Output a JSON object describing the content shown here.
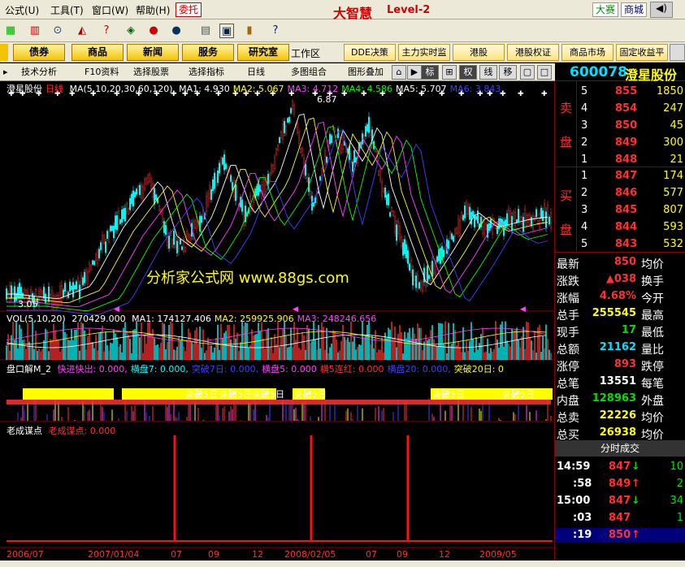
{
  "app": {
    "logo_text": "大智慧",
    "level_text": "Level-2"
  },
  "menu": {
    "items": [
      "公式(U)",
      "工具(T)",
      "窗口(W)",
      "帮助(H)"
    ],
    "tag_left": "委托",
    "tag_right1": "大赛",
    "tag_right2": "商城"
  },
  "toolbar": {
    "icons": [
      "grid-icon",
      "bars-icon",
      "binoculars-icon",
      "megaphone-icon",
      "question-icon",
      "scroll-icon",
      "flag-icon",
      "f10-icon",
      "chart-icon",
      "window-icon",
      "books-icon",
      "help-icon"
    ]
  },
  "funcbar": {
    "buttons": [
      "债券",
      "商品",
      "新闻",
      "服务",
      "研究室"
    ],
    "workspace": "工作区",
    "buttons2": [
      "DDE决策",
      "主力实时监控",
      "港股",
      "港股权证",
      "商品市场",
      "固定收益平台"
    ]
  },
  "tabs": {
    "items": [
      "技术分析",
      "F10资料",
      "选择股票",
      "选择指标",
      "日线",
      "多图组合",
      "图形叠加"
    ],
    "ctrl": [
      "标",
      "⊞",
      "权",
      "线",
      "移"
    ]
  },
  "chart": {
    "title": "澄星股份",
    "period": "日线",
    "ma_label": "MA(5,10,20,30,60,120)",
    "ma_values": [
      {
        "k": "MA1:",
        "v": "4.930",
        "c": "#ffffff"
      },
      {
        "k": "MA2:",
        "v": "5.067",
        "c": "#ffff00"
      },
      {
        "k": "MA3:",
        "v": "4.712",
        "c": "#ff40ff"
      },
      {
        "k": "MA4:",
        "v": "4.586",
        "c": "#00ff00"
      },
      {
        "k": "MA5:",
        "v": "5.707",
        "c": "#ffffff"
      },
      {
        "k": "MA6:",
        "v": "3.843",
        "c": "#4040ff"
      }
    ],
    "high_label": "6.87",
    "low_label": "3.05",
    "watermark": "分析家公式网 www.88gs.com",
    "vol_label": "VOL(5,10,20)",
    "vol_value": "270429.000",
    "vol_mas": [
      {
        "k": "MA1:",
        "v": "174127.406",
        "c": "#ffffff"
      },
      {
        "k": "MA2:",
        "v": "259925.906",
        "c": "#ffff00"
      },
      {
        "k": "MA3:",
        "v": "248246.656",
        "c": "#ff40ff"
      }
    ],
    "ind1_title": "盘口解M_2",
    "ind1_items": [
      {
        "t": "快进快出: 0.000,",
        "c": "#ff40ff"
      },
      {
        "t": "横盘7: 0.000,",
        "c": "#00ffff"
      },
      {
        "t": "突破7日: 0.000,",
        "c": "#4040ff"
      },
      {
        "t": "横盘5: 0.000",
        "c": "#ff40ff"
      },
      {
        "t": "横5连红: 0.000",
        "c": "#ff3030"
      },
      {
        "t": "横盘20: 0.000,",
        "c": "#4040ff"
      },
      {
        "t": "突破20日: 0",
        "c": "#ffff00"
      }
    ],
    "ind1_marks": [
      "突破5日",
      "突破5日",
      "突破5日",
      "突破5日",
      "突破5日",
      "突破5日"
    ],
    "ind2_title": "老成谋点",
    "ind2_item": "老成谋点: 0.000",
    "xaxis": [
      "2006/07",
      "2007/01/04",
      "07",
      "09",
      "12",
      "2008/02/05",
      "07",
      "09",
      "12",
      "2009/05"
    ]
  },
  "quote": {
    "code": "600078",
    "name": "澄星股份",
    "sell_label": [
      "卖",
      "盘"
    ],
    "buy_label": [
      "买",
      "盘"
    ],
    "sell": [
      {
        "lv": "5",
        "p": "855",
        "v": "1850"
      },
      {
        "lv": "4",
        "p": "854",
        "v": "247"
      },
      {
        "lv": "3",
        "p": "850",
        "v": "45"
      },
      {
        "lv": "2",
        "p": "849",
        "v": "300"
      },
      {
        "lv": "1",
        "p": "848",
        "v": "21"
      }
    ],
    "buy": [
      {
        "lv": "1",
        "p": "847",
        "v": "174"
      },
      {
        "lv": "2",
        "p": "846",
        "v": "577"
      },
      {
        "lv": "3",
        "p": "845",
        "v": "807"
      },
      {
        "lv": "4",
        "p": "844",
        "v": "593"
      },
      {
        "lv": "5",
        "p": "843",
        "v": "532"
      }
    ],
    "stats": [
      {
        "k": "最新",
        "v": "850",
        "c": "#ff3030",
        "k2": "均价"
      },
      {
        "k": "涨跌",
        "v": "▲038",
        "c": "#ff3030",
        "k2": "换手"
      },
      {
        "k": "涨幅",
        "v": "4.68%",
        "c": "#ff3030",
        "k2": "今开"
      },
      {
        "k": "总手",
        "v": "255545",
        "c": "#ffff00",
        "k2": "最高"
      },
      {
        "k": "现手",
        "v": "17",
        "c": "#00e000",
        "k2": "最低"
      },
      {
        "k": "总额",
        "v": "21162",
        "c": "#00e0ff",
        "k2": "量比"
      },
      {
        "k": "涨停",
        "v": "893",
        "c": "#ff3030",
        "k2": "跌停"
      },
      {
        "k": "总笔",
        "v": "13551",
        "c": "#ffffff",
        "k2": "每笔"
      },
      {
        "k": "内盘",
        "v": "128963",
        "c": "#00e000",
        "k2": "外盘"
      },
      {
        "k": "总卖",
        "v": "22226",
        "c": "#ffff00",
        "k2": "均价"
      },
      {
        "k": "总买",
        "v": "26938",
        "c": "#ffff00",
        "k2": "均价"
      }
    ],
    "ticks_title": "分时成交",
    "ticks": [
      {
        "t": "14:59",
        "p": "847",
        "a": "↓",
        "ac": "#00e000",
        "v": "10"
      },
      {
        "t": ":58",
        "p": "849",
        "a": "↑",
        "ac": "#ff3030",
        "v": "2"
      },
      {
        "t": "15:00",
        "p": "847",
        "a": "↓",
        "ac": "#00e000",
        "v": "34"
      },
      {
        "t": ":03",
        "p": "847",
        "a": "",
        "ac": "#ff3030",
        "v": "1"
      },
      {
        "t": ":19",
        "p": "850",
        "a": "↑",
        "ac": "#ff3030",
        "v": ""
      }
    ]
  }
}
